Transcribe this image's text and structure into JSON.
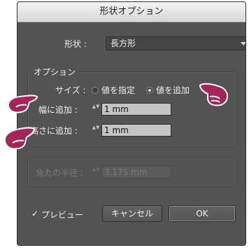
{
  "window": {
    "title": "形状オプション"
  },
  "shape": {
    "label": "形状 :",
    "value": "長方形"
  },
  "options": {
    "group_label": "オプション",
    "size_label": "サイズ :",
    "radio_specify": "値を指定",
    "radio_add": "値を追加",
    "radio_selected": "値を追加",
    "width_label": "幅に追加 :",
    "width_value": "1 mm",
    "height_label": "高さに追加 :",
    "height_value": "1 mm"
  },
  "corner": {
    "label": "角丸の半径 :",
    "value": "3.175 mm"
  },
  "footer": {
    "preview_check": "✓",
    "preview_label": "プレビュー",
    "cancel_label": "キャンセル",
    "ok_label": "OK"
  },
  "icons": {
    "stepper": "▲▼",
    "pointer": "pointing-hand-icon"
  },
  "colors": {
    "dialog_bg": "#535353",
    "pointer_hand": "#a5245a"
  }
}
